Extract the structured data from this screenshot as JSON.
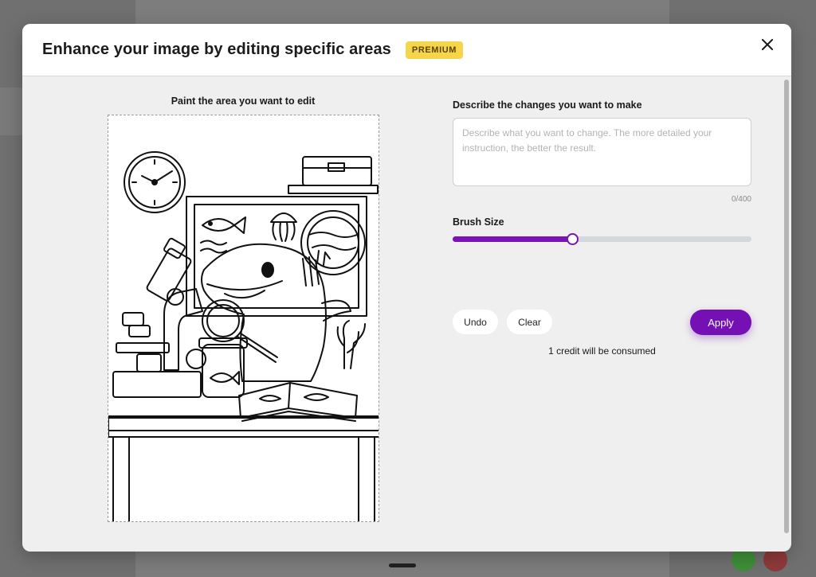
{
  "modal": {
    "title": "Enhance your image by editing specific areas",
    "badge": "PREMIUM",
    "close_icon": "close-icon"
  },
  "canvas": {
    "label": "Paint the area you want to edit"
  },
  "description": {
    "label": "Describe the changes you want to make",
    "placeholder": "Describe what you want to change. The more detailed your instruction, the better the result.",
    "value": "",
    "char_count": "0/400"
  },
  "brush": {
    "label": "Brush Size",
    "level_percent": 40
  },
  "actions": {
    "undo": "Undo",
    "clear": "Clear",
    "apply": "Apply"
  },
  "credit_note": "1 credit will be consumed",
  "colors": {
    "accent": "#7410b4",
    "badge_bg": "#f7d54a",
    "panel_bg": "#efefef"
  }
}
